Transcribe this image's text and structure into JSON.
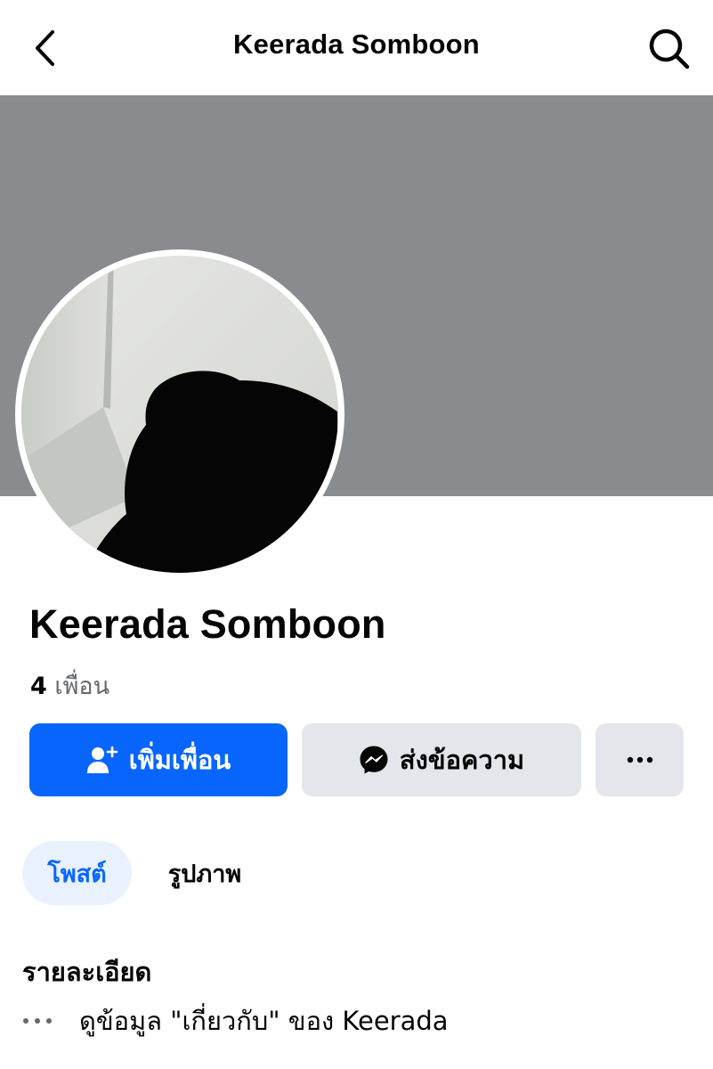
{
  "header": {
    "title": "Keerada Somboon",
    "back_icon": "chevron-left-icon",
    "search_icon": "search-icon"
  },
  "profile": {
    "name": "Keerada Somboon",
    "friends_count": "4",
    "friends_label": "เพื่อน"
  },
  "actions": {
    "add_friend_label": "เพิ่มเพื่อน",
    "message_label": "ส่งข้อความ",
    "more_icon": "more-horizontal-icon"
  },
  "tabs": [
    {
      "label": "โพสต์",
      "active": true
    },
    {
      "label": "รูปภาพ",
      "active": false
    }
  ],
  "details": {
    "title": "รายละเอียด",
    "about_text": "ดูข้อมูล \"เกี่ยวกับ\" ของ Keerada"
  },
  "colors": {
    "accent": "#0866ff",
    "cover": "#8a8b8f",
    "button_secondary": "#e4e6eb",
    "tab_active_bg": "#e8f1fd"
  }
}
